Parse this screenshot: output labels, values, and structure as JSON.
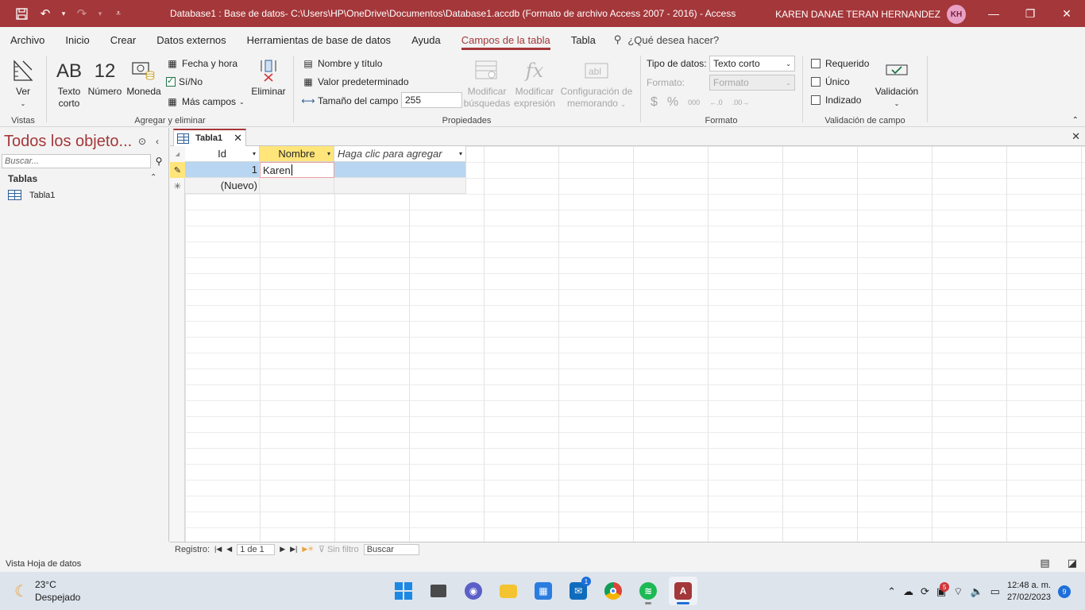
{
  "titlebar": {
    "title": "Database1 : Base de datos- C:\\Users\\HP\\OneDrive\\Documentos\\Database1.accdb (Formato de archivo Access 2007 - 2016)  -  Access",
    "user_name": "KAREN DANAE TERAN HERNANDEZ",
    "user_initials": "KH",
    "accent_color": "#a4373a"
  },
  "tabs": {
    "items": [
      "Archivo",
      "Inicio",
      "Crear",
      "Datos externos",
      "Herramientas de base de datos",
      "Ayuda",
      "Campos de la tabla",
      "Tabla"
    ],
    "active": "Campos de la tabla",
    "tell_me": "¿Qué desea hacer?"
  },
  "ribbon": {
    "vistas": {
      "label": "Vistas",
      "ver": "Ver"
    },
    "agregar": {
      "label": "Agregar y eliminar",
      "texto_corto_icon": "AB",
      "texto_corto_1": "Texto",
      "texto_corto_2": "corto",
      "numero_icon": "12",
      "numero": "Número",
      "moneda": "Moneda",
      "fecha": "Fecha y hora",
      "sino": "Sí/No",
      "mas": "Más campos",
      "eliminar": "Eliminar"
    },
    "propiedades": {
      "label": "Propiedades",
      "nombre_titulo": "Nombre y título",
      "valor_pred": "Valor predeterminado",
      "tamano_label": "Tamaño del campo",
      "tamano_value": "255",
      "mod_busq_1": "Modificar",
      "mod_busq_2": "búsquedas",
      "mod_expr_1": "Modificar",
      "mod_expr_2": "expresión",
      "config_memo_1": "Configuración de",
      "config_memo_2": "memorando"
    },
    "formato": {
      "label": "Formato",
      "tipo_label": "Tipo de datos:",
      "tipo_value": "Texto corto",
      "formato_label": "Formato:",
      "formato_value": "Formato",
      "thousands": "000"
    },
    "validacion": {
      "label": "Validación de campo",
      "requerido": "Requerido",
      "unico": "Único",
      "indizado": "Indizado",
      "validacion": "Validación"
    }
  },
  "nav": {
    "title": "Todos los objeto...",
    "search_placeholder": "Buscar...",
    "section": "Tablas",
    "items": [
      "Tabla1"
    ]
  },
  "document": {
    "tab_label": "Tabla1",
    "columns": [
      "Id",
      "Nombre",
      "Haga clic para agregar"
    ],
    "rows": [
      {
        "id": "1",
        "nombre": "Karen"
      }
    ],
    "new_row": "(Nuevo)"
  },
  "record_nav": {
    "label": "Registro:",
    "position": "1 de 1",
    "filter": "Sin filtro",
    "search": "Buscar"
  },
  "status": {
    "text": "Vista Hoja de datos"
  },
  "taskbar": {
    "temp": "23°C",
    "weather": "Despejado",
    "mail_badge": "1",
    "time": "12:48 a. m.",
    "date": "27/02/2023",
    "notifications": "9",
    "tray_badge": "5"
  }
}
